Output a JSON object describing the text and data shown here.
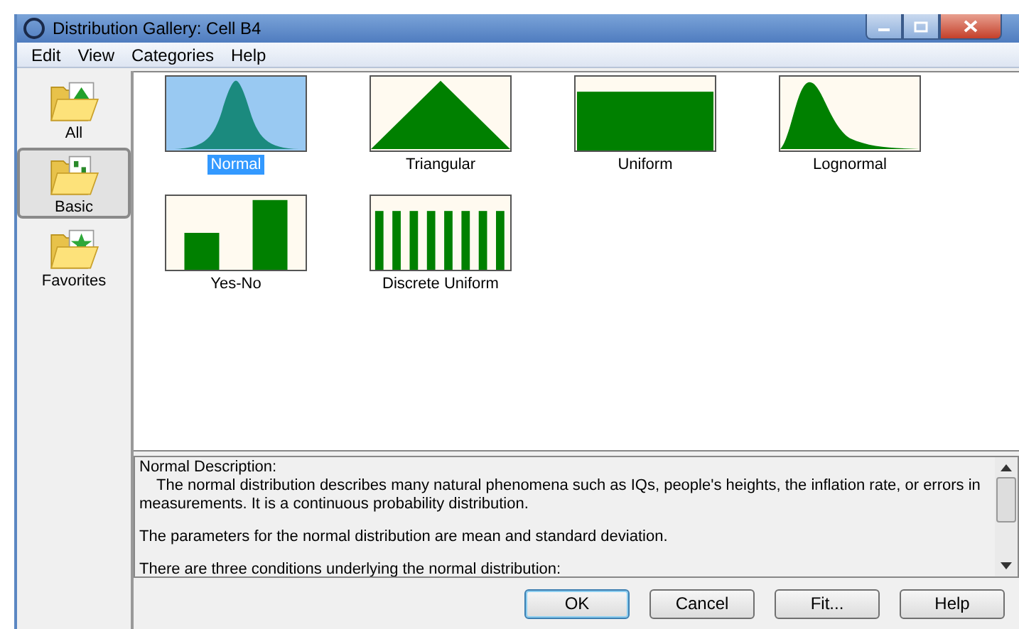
{
  "window": {
    "title": "Distribution Gallery: Cell B4"
  },
  "menu": [
    "Edit",
    "View",
    "Categories",
    "Help"
  ],
  "sidebar": {
    "items": [
      {
        "label": "All",
        "kind": "all",
        "selected": false
      },
      {
        "label": "Basic",
        "kind": "basic",
        "selected": true
      },
      {
        "label": "Favorites",
        "kind": "favorites",
        "selected": false
      }
    ]
  },
  "gallery": {
    "items": [
      {
        "label": "Normal",
        "kind": "normal",
        "selected": true
      },
      {
        "label": "Triangular",
        "kind": "triangular",
        "selected": false
      },
      {
        "label": "Uniform",
        "kind": "uniform",
        "selected": false
      },
      {
        "label": "Lognormal",
        "kind": "lognormal",
        "selected": false
      },
      {
        "label": "Yes-No",
        "kind": "yesno",
        "selected": false
      },
      {
        "label": "Discrete Uniform",
        "kind": "discrete",
        "selected": false
      }
    ]
  },
  "description": {
    "title": "Normal Description:",
    "paragraphs": [
      "The normal distribution describes many natural phenomena such as IQs, people's heights, the inflation rate, or errors in measurements. It is a continuous probability distribution.",
      "The parameters for the normal distribution are mean and standard deviation.",
      "There are three conditions underlying the normal distribution:"
    ]
  },
  "buttons": [
    {
      "label": "OK",
      "kind": "default"
    },
    {
      "label": "Cancel",
      "kind": "normal"
    },
    {
      "label": "Fit...",
      "kind": "normal"
    },
    {
      "label": "Help",
      "kind": "normal"
    }
  ]
}
